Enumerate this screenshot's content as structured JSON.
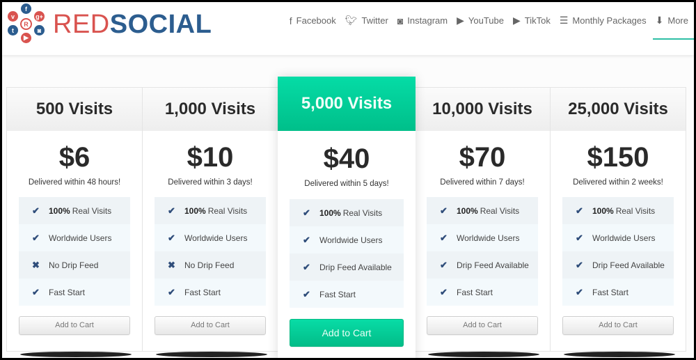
{
  "brand": {
    "name_part1": "RED",
    "name_part2": "SOCIAL",
    "logo_center_letter": "R",
    "colors": {
      "red": "#d9534f",
      "blue": "#2c5d8f",
      "accent": "#2ebfa5",
      "featured_green": "#00c896",
      "check_blue": "#2f4d7a"
    }
  },
  "nav": {
    "items": [
      {
        "label": "Facebook",
        "icon": "f"
      },
      {
        "label": "Twitter",
        "icon": "🐦"
      },
      {
        "label": "Instagram",
        "icon": "◙"
      },
      {
        "label": "YouTube",
        "icon": "▶"
      },
      {
        "label": "TikTok",
        "icon": "▶"
      },
      {
        "label": "Monthly Packages",
        "icon": "☰"
      },
      {
        "label": "More",
        "icon": "🡇"
      }
    ],
    "active": "More"
  },
  "plans": [
    {
      "title": "500 Visits",
      "price": "$6",
      "delivery": "Delivered within 48 hours!",
      "features": [
        {
          "mark": "✔",
          "bold": "100%",
          "text": "Real Visits"
        },
        {
          "mark": "✔",
          "bold": "",
          "text": "Worldwide Users"
        },
        {
          "mark": "✖",
          "bold": "",
          "text": "No Drip Feed"
        },
        {
          "mark": "✔",
          "bold": "",
          "text": "Fast Start"
        }
      ],
      "button": "Add to Cart"
    },
    {
      "title": "1,000 Visits",
      "price": "$10",
      "delivery": "Delivered within 3 days!",
      "features": [
        {
          "mark": "✔",
          "bold": "100%",
          "text": "Real Visits"
        },
        {
          "mark": "✔",
          "bold": "",
          "text": "Worldwide Users"
        },
        {
          "mark": "✖",
          "bold": "",
          "text": "No Drip Feed"
        },
        {
          "mark": "✔",
          "bold": "",
          "text": "Fast Start"
        }
      ],
      "button": "Add to Cart"
    },
    {
      "title": "5,000 Visits",
      "price": "$40",
      "delivery": "Delivered within 5 days!",
      "featured": true,
      "features": [
        {
          "mark": "✔",
          "bold": "100%",
          "text": "Real Visits"
        },
        {
          "mark": "✔",
          "bold": "",
          "text": "Worldwide Users"
        },
        {
          "mark": "✔",
          "bold": "",
          "text": "Drip Feed Available"
        },
        {
          "mark": "✔",
          "bold": "",
          "text": "Fast Start"
        }
      ],
      "button": "Add to Cart"
    },
    {
      "title": "10,000 Visits",
      "price": "$70",
      "delivery": "Delivered within 7 days!",
      "features": [
        {
          "mark": "✔",
          "bold": "100%",
          "text": "Real Visits"
        },
        {
          "mark": "✔",
          "bold": "",
          "text": "Worldwide Users"
        },
        {
          "mark": "✔",
          "bold": "",
          "text": "Drip Feed Available"
        },
        {
          "mark": "✔",
          "bold": "",
          "text": "Fast Start"
        }
      ],
      "button": "Add to Cart"
    },
    {
      "title": "25,000 Visits",
      "price": "$150",
      "delivery": "Delivered within 2 weeks!",
      "features": [
        {
          "mark": "✔",
          "bold": "100%",
          "text": "Real Visits"
        },
        {
          "mark": "✔",
          "bold": "",
          "text": "Worldwide Users"
        },
        {
          "mark": "✔",
          "bold": "",
          "text": "Drip Feed Available"
        },
        {
          "mark": "✔",
          "bold": "",
          "text": "Fast Start"
        }
      ],
      "button": "Add to Cart"
    }
  ]
}
